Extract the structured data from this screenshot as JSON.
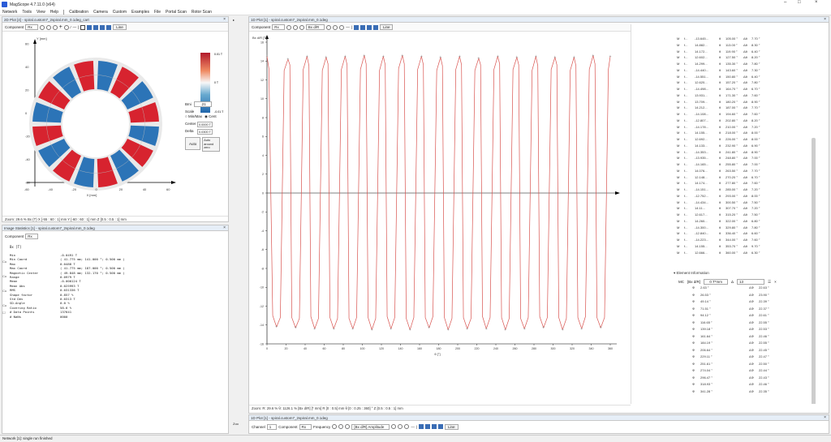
{
  "window": {
    "title": "MagScope 4.7.11.0 (x64)",
    "controls": [
      "–",
      "□",
      "×"
    ]
  },
  "menu": [
    "Network",
    "Tools",
    "View",
    "Help",
    "Calibration",
    "Camera",
    "Custom",
    "Examples",
    "File",
    "Portal Scan",
    "Rotor Scan"
  ],
  "plot2d": {
    "header": "2D Plot [4] - spiral.custom7_2spiral.mm_0.1deg_cart",
    "component_label": "Component",
    "component_value": "Rx",
    "line_btn": "Line",
    "colorbar_ticks": [
      "0.01 T",
      "0 T",
      "-0.01 T"
    ],
    "bmi_label": "Bmi",
    "bmi_value": ".21",
    "scale_label": "Scale",
    "minmax_label": "Min/Max",
    "center_option": "Cent",
    "center_label": "Center",
    "center_value": "0.0000 T",
    "delta_label": "Delta",
    "delta_value": "0.0300 T",
    "auto_btn": "Auto",
    "auto_around_btn": "Auto around zero",
    "yaxis_label": "Y [mm]",
    "xaxis_label": "X [mm]",
    "yticks": [
      "60",
      "40",
      "20",
      "0",
      "-20",
      "-40",
      "-60"
    ],
    "xticks": [
      "-60",
      "-40",
      "-20",
      "0",
      "20",
      "40",
      "60"
    ],
    "status": "Zoom: 29.6 %    Bx (T) X [-55 : 60 : 1] mm Y [-60 : 60 : 1] mm Z [0.5 : 0.5 : 1] mm"
  },
  "stats": {
    "header": "Image Statistics [1] - spiral.custom7_2spiral.mm_0.1deg",
    "component_label": "Component",
    "component_value": "Rx",
    "unit": "Bx [T]",
    "rows": [
      [
        "Min",
        "-0.0491 T"
      ],
      [
        "Min Coord",
        "( 41.775 mm; 141.000 °; 0.500 mm )"
      ],
      [
        "Max",
        "0.0488 T"
      ],
      [
        "Max Coord",
        "( 41.775 mm; 187.000 °; 0.500 mm )"
      ],
      [
        "Magnetic Center",
        "( 49.848 mm; 132.170 °; 0.500 mm )"
      ],
      [
        "Range",
        "0.0979 T"
      ],
      [
        "Mean",
        "-0.000124 T"
      ],
      [
        "Mean Abs",
        "0.025993 T"
      ],
      [
        "RMS",
        "0.031336 T"
      ],
      [
        "Shape factor",
        "0.857 %"
      ],
      [
        "Std Dev",
        "0.0313 T"
      ],
      [
        "SD-Angle",
        "0.0 %"
      ],
      [
        "Covering Ratio",
        "58.6 %"
      ],
      [
        "# Data Points",
        "137641"
      ],
      [
        "# NaNs",
        "0000"
      ]
    ]
  },
  "plot1d": {
    "header": "1D Plot [1] - spiral.custom7_2spiral.mm_0.1deg",
    "component_label": "Component",
    "component_value": "Rx",
    "axis_sel": "Bx d/R",
    "line_btn": "Line",
    "ylabel": "Bx d/R [T]",
    "xlabel": "θ [°]",
    "status": "Zoom: R: 29.6 %  θ: 1126.1 %    [Bx d/R] [* mm] R [0 : 0.5] mm θ [0 : 0.25 : 360] ° Z [0.5 : 0.5 : 1] mm"
  },
  "chart_data": {
    "type": "line",
    "title": "",
    "xlabel": "θ [°]",
    "ylabel": "Bx d/R [T]",
    "xlim": [
      0,
      360
    ],
    "ylim": [
      -16,
      16
    ],
    "xticks": [
      0,
      20,
      40,
      60,
      80,
      100,
      120,
      140,
      160,
      180,
      200,
      220,
      240,
      260,
      280,
      300,
      320,
      340,
      360
    ],
    "yticks": [
      16,
      14,
      12,
      10,
      8,
      6,
      4,
      2,
      0,
      -2,
      -4,
      -6,
      -8,
      -10,
      -12,
      -14,
      -16
    ],
    "series": [
      {
        "x": [
          0,
          2,
          6,
          10,
          14,
          18,
          22,
          24,
          26,
          30,
          34,
          38,
          42,
          44,
          46,
          50,
          54,
          58,
          62,
          64,
          66,
          70,
          74,
          78,
          82,
          84,
          86,
          90,
          94,
          98,
          102,
          104,
          106,
          110,
          114,
          118,
          122,
          124,
          126,
          130,
          134,
          138,
          142,
          144,
          146,
          150,
          154,
          158,
          162,
          164,
          166,
          170,
          174,
          178,
          182,
          184,
          186,
          190,
          194,
          198,
          202,
          204,
          206,
          210,
          214,
          218,
          222,
          224,
          226,
          230,
          234,
          238,
          242,
          244,
          246,
          250,
          254,
          258,
          262,
          264,
          266,
          270,
          274,
          278,
          282,
          284,
          286,
          290,
          294,
          298,
          302,
          304,
          306,
          310,
          314,
          318,
          322,
          324,
          326,
          330,
          334,
          338,
          342,
          344,
          346,
          350,
          354,
          358,
          360
        ],
        "values": [
          14.5,
          13.2,
          -13.0,
          -14.2,
          -13.2,
          13.0,
          14.2,
          13.6,
          -13.2,
          -14.3,
          -13.3,
          13.1,
          14.5,
          13.5,
          -13.1,
          -14.4,
          -13.3,
          13.0,
          14.4,
          13.7,
          -13.2,
          -14.4,
          -13.3,
          13.1,
          14.5,
          13.6,
          -13.3,
          -14.4,
          -13.2,
          13.1,
          14.6,
          13.7,
          -13.2,
          -14.5,
          -13.3,
          13.0,
          14.5,
          13.6,
          -13.1,
          -14.4,
          -13.2,
          13.2,
          14.6,
          13.7,
          -13.3,
          -14.5,
          -13.2,
          13.1,
          14.5,
          13.6,
          -13.2,
          -14.3,
          -13.1,
          13.0,
          14.4,
          13.5,
          -13.2,
          -14.5,
          -13.3,
          13.1,
          14.5,
          13.6,
          -13.2,
          -14.4,
          -13.3,
          13.0,
          14.3,
          13.6,
          -13.1,
          -14.4,
          -13.2,
          13.1,
          14.5,
          13.7,
          -13.2,
          -14.5,
          -13.3,
          13.1,
          14.4,
          13.6,
          -13.3,
          -14.4,
          -13.2,
          13.0,
          14.5,
          13.5,
          -13.1,
          -14.3,
          -13.2,
          13.1,
          14.4,
          13.6,
          -13.2,
          -14.5,
          -13.3,
          13.0,
          14.4,
          13.5,
          -13.2,
          -14.4,
          -13.1,
          13.1,
          14.6,
          13.7,
          -13.2,
          -14.3,
          -13.2,
          13.1,
          14.5
        ]
      }
    ]
  },
  "pole_table": {
    "rows": [
      [
        "M",
        "f...",
        "-13.645...",
        "θ",
        "105.00 °",
        "Δθ",
        "7.70 °"
      ],
      [
        "M",
        "f...",
        "14.882...",
        "θ",
        "113.00 °",
        "Δθ",
        "8.30 °"
      ],
      [
        "M",
        "f...",
        "14.172...",
        "θ",
        "119.90 °",
        "Δθ",
        "6.40 °"
      ],
      [
        "M",
        "f...",
        "12.602...",
        "θ",
        "127.50 °",
        "Δθ",
        "8.20 °"
      ],
      [
        "M",
        "f...",
        "14.299...",
        "θ",
        "135.30 °",
        "Δθ",
        "7.80 °"
      ],
      [
        "M",
        "f...",
        "-14.440...",
        "θ",
        "143.60 °",
        "Δθ",
        "7.30 °"
      ],
      [
        "M",
        "f...",
        "-14.551...",
        "θ",
        "150.80 °",
        "Δθ",
        "6.40 °"
      ],
      [
        "M",
        "f...",
        "12.620...",
        "θ",
        "157.20 °",
        "Δθ",
        "7.80 °"
      ],
      [
        "M",
        "f...",
        "-14.498...",
        "θ",
        "164.70 °",
        "Δθ",
        "6.70 °"
      ],
      [
        "M",
        "f...",
        "13.931...",
        "θ",
        "171.30 °",
        "Δθ",
        "7.60 °"
      ],
      [
        "M",
        "f...",
        "13.709...",
        "θ",
        "180.20 °",
        "Δθ",
        "8.90 °"
      ],
      [
        "M",
        "f...",
        "14.212...",
        "θ",
        "187.00 °",
        "Δθ",
        "7.70 °"
      ],
      [
        "M",
        "f...",
        "-14.108...",
        "θ",
        "194.60 °",
        "Δθ",
        "7.60 °"
      ],
      [
        "M",
        "f...",
        "-12.807...",
        "θ",
        "202.80 °",
        "Δθ",
        "8.20 °"
      ],
      [
        "M",
        "f...",
        "-14.178...",
        "θ",
        "210.00 °",
        "Δθ",
        "7.20 °"
      ],
      [
        "M",
        "f...",
        "14.155...",
        "θ",
        "218.00 °",
        "Δθ",
        "8.00 °"
      ],
      [
        "M",
        "f...",
        "12.692...",
        "θ",
        "226.00 °",
        "Δθ",
        "8.00 °"
      ],
      [
        "M",
        "f...",
        "14.133...",
        "θ",
        "232.90 °",
        "Δθ",
        "6.90 °"
      ],
      [
        "M",
        "f...",
        "-14.353...",
        "θ",
        "241.80 °",
        "Δθ",
        "8.90 °"
      ],
      [
        "M",
        "f...",
        "-13.935...",
        "θ",
        "248.80 °",
        "Δθ",
        "7.00 °"
      ],
      [
        "M",
        "f...",
        "-14.165...",
        "θ",
        "255.80 °",
        "Δθ",
        "7.00 °"
      ],
      [
        "M",
        "f...",
        "14.076...",
        "θ",
        "263.50 °",
        "Δθ",
        "7.70 °"
      ],
      [
        "M",
        "f...",
        "12.148...",
        "θ",
        "270.20 °",
        "Δθ",
        "6.70 °"
      ],
      [
        "M",
        "f...",
        "14.174...",
        "θ",
        "277.80 °",
        "Δθ",
        "7.60 °"
      ],
      [
        "M",
        "f...",
        "-14.151...",
        "θ",
        "285.00 °",
        "Δθ",
        "7.20 °"
      ],
      [
        "M",
        "f...",
        "-12.752...",
        "θ",
        "293.00 °",
        "Δθ",
        "8.00 °"
      ],
      [
        "M",
        "f...",
        "-14.434...",
        "θ",
        "300.50 °",
        "Δθ",
        "7.50 °"
      ],
      [
        "M",
        "f...",
        "14.11...",
        "θ",
        "307.70 °",
        "Δθ",
        "7.20 °"
      ],
      [
        "M",
        "f...",
        "12.617...",
        "θ",
        "315.20 °",
        "Δθ",
        "7.50 °"
      ],
      [
        "M",
        "f...",
        "14.260...",
        "θ",
        "322.00 °",
        "Δθ",
        "6.80 °"
      ],
      [
        "M",
        "f...",
        "-14.300...",
        "θ",
        "329.80 °",
        "Δθ",
        "7.80 °"
      ],
      [
        "M",
        "f...",
        "-12.840...",
        "θ",
        "336.40 °",
        "Δθ",
        "6.60 °"
      ],
      [
        "M",
        "f...",
        "-14.223...",
        "θ",
        "344.00 °",
        "Δθ",
        "7.60 °"
      ],
      [
        "M",
        "f...",
        "14.155...",
        "θ",
        "353.70 °",
        "Δθ",
        "9.70 °"
      ],
      [
        "M",
        "f...",
        "12.666...",
        "θ",
        "360.00 °",
        "Δθ",
        "6.30 °"
      ]
    ]
  },
  "element_info": {
    "title": "Element Information",
    "mc_label": "MC",
    "ax_label": "[Bx d/R]",
    "unit_sel": "0 T*mm",
    "r_label": "Δ",
    "r_value": "13",
    "rows": [
      [
        "Φ",
        "2.63 °",
        "ΔΦ",
        "22.63 °"
      ],
      [
        "Φ",
        "26.53 °",
        "ΔΦ",
        "23.90 °"
      ],
      [
        "Φ",
        "49.14 °",
        "ΔΦ",
        "22.39 °"
      ],
      [
        "Φ",
        "71.51 °",
        "ΔΦ",
        "22.37 °"
      ],
      [
        "Φ",
        "94.12 °",
        "ΔΦ",
        "22.61 °"
      ],
      [
        "Φ",
        "116.65 °",
        "ΔΦ",
        "22.55 °"
      ],
      [
        "Φ",
        "139.18 °",
        "ΔΦ",
        "22.53 °"
      ],
      [
        "Φ",
        "161.64 °",
        "ΔΦ",
        "22.46 °"
      ],
      [
        "Φ",
        "184.19 °",
        "ΔΦ",
        "22.55 °"
      ],
      [
        "Φ",
        "206.64 °",
        "ΔΦ",
        "22.45 °"
      ],
      [
        "Φ",
        "229.11 °",
        "ΔΦ",
        "22.47 °"
      ],
      [
        "Φ",
        "251.61 °",
        "ΔΦ",
        "22.50 °"
      ],
      [
        "Φ",
        "274.04 °",
        "ΔΦ",
        "22.44 °"
      ],
      [
        "Φ",
        "296.47 °",
        "ΔΦ",
        "22.43 °"
      ],
      [
        "Φ",
        "318.93 °",
        "ΔΦ",
        "22.46 °"
      ],
      [
        "Φ",
        "341.28 °",
        "ΔΦ",
        "22.35 °"
      ]
    ]
  },
  "bottom_panel": {
    "header": "1D Plot [1] - spiral.custom7_2spiral.mm_0.1deg",
    "zoom_label": "Zoo",
    "channel_label": "Channel",
    "channel_value": "1",
    "component_label": "Component",
    "component_value": "Rx",
    "frequency_label": "Frequency",
    "amp_label": "[Bx d/R] Amplitude",
    "line_btn": "Line"
  },
  "statusbar": "Network [1]: single run finished"
}
